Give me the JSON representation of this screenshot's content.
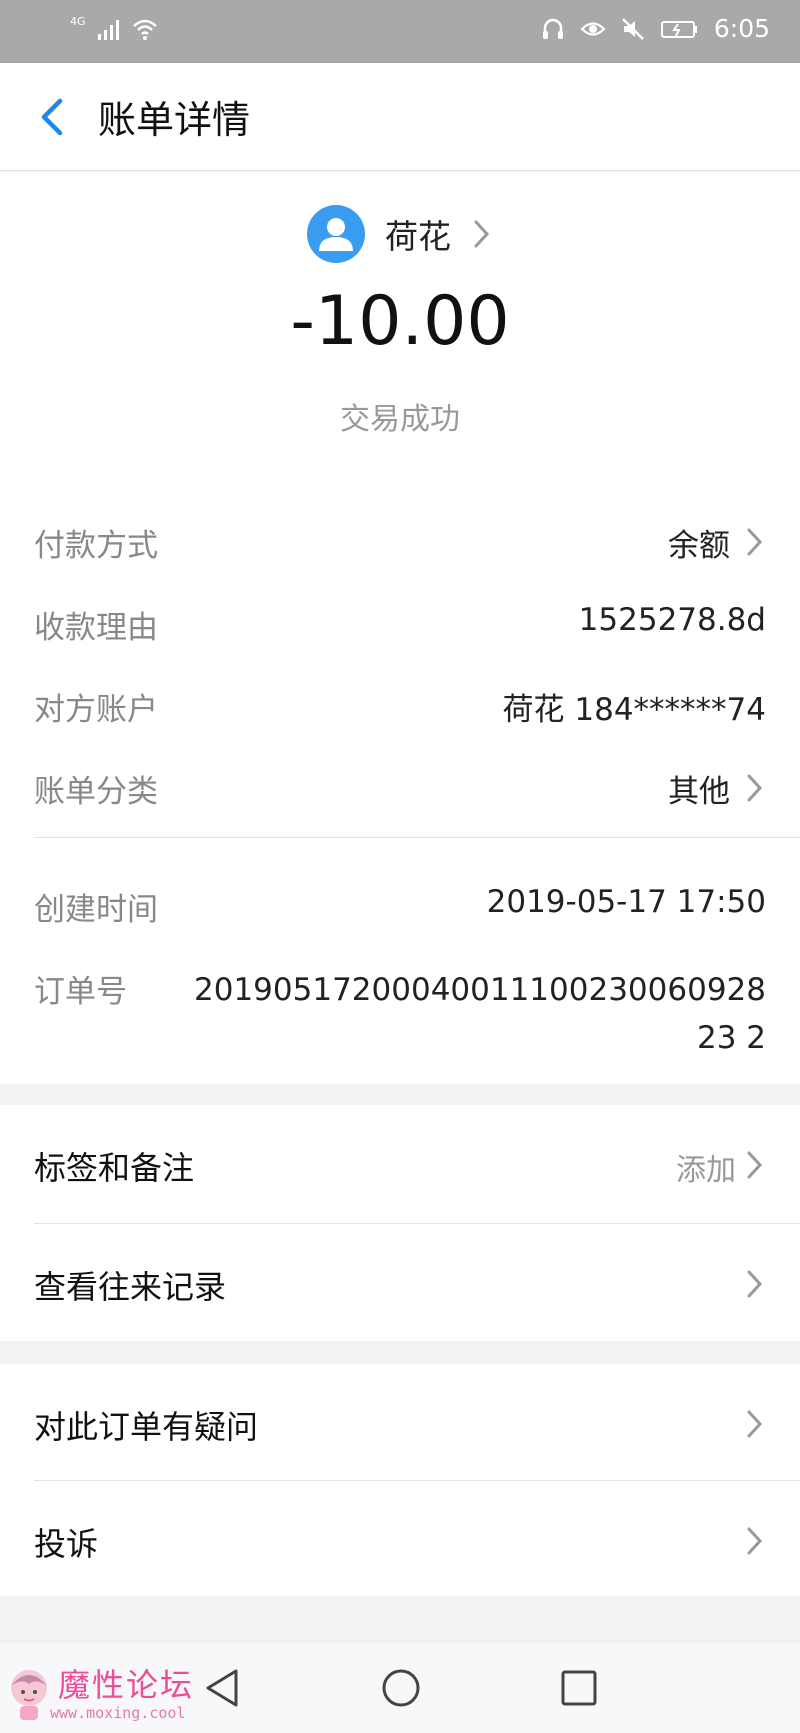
{
  "status_bar": {
    "network": "4G",
    "time": "6:05"
  },
  "header": {
    "title": "账单详情"
  },
  "summary": {
    "payee_name": "荷花",
    "amount": "-10.00",
    "status": "交易成功"
  },
  "details": {
    "payment_method": {
      "label": "付款方式",
      "value": "余额"
    },
    "reason": {
      "label": "收款理由",
      "value": "1525278.8d"
    },
    "counterparty": {
      "label": "对方账户",
      "value": "荷花 184******74"
    },
    "category": {
      "label": "账单分类",
      "value": "其他"
    },
    "created_time": {
      "label": "创建时间",
      "value": "2019-05-17 17:50"
    },
    "order_no": {
      "label": "订单号",
      "value": "2019051720004001110023006092823 2"
    }
  },
  "menu1": {
    "tags": {
      "label": "标签和备注",
      "extra": "添加"
    },
    "history": {
      "label": "查看往来记录"
    }
  },
  "menu2": {
    "question": {
      "label": "对此订单有疑问"
    },
    "complaint": {
      "label": "投诉"
    }
  },
  "watermark": {
    "text": "魔性论坛",
    "url": "www.moxing.cool"
  },
  "colors": {
    "accent": "#1e88e5",
    "avatar": "#3a9cf0",
    "label_gray": "#888888",
    "watermark_pink": "#f04b9a"
  }
}
